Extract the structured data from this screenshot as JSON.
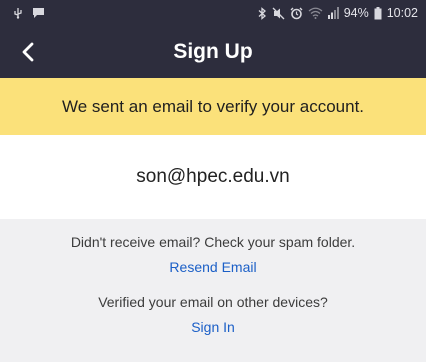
{
  "status_bar": {
    "battery": "94%",
    "time": "10:02",
    "icons_left": [
      "usb-icon",
      "message-icon"
    ],
    "icons_right": [
      "bluetooth-icon",
      "mute-icon",
      "alarm-icon",
      "wifi-icon",
      "signal-icon",
      "battery-icon"
    ]
  },
  "header": {
    "title": "Sign Up"
  },
  "banner": {
    "text": "We sent an email to verify your account."
  },
  "email": {
    "address": "son@hpec.edu.vn"
  },
  "resend": {
    "prompt": "Didn't receive email? Check your spam folder.",
    "link": "Resend Email"
  },
  "signin": {
    "prompt": "Verified your email on other devices?",
    "link": "Sign In"
  },
  "colors": {
    "header_bg": "#2d2d3d",
    "banner_bg": "#fbe17a",
    "link": "#1b5fc7",
    "page_bg": "#f0f0f2"
  }
}
